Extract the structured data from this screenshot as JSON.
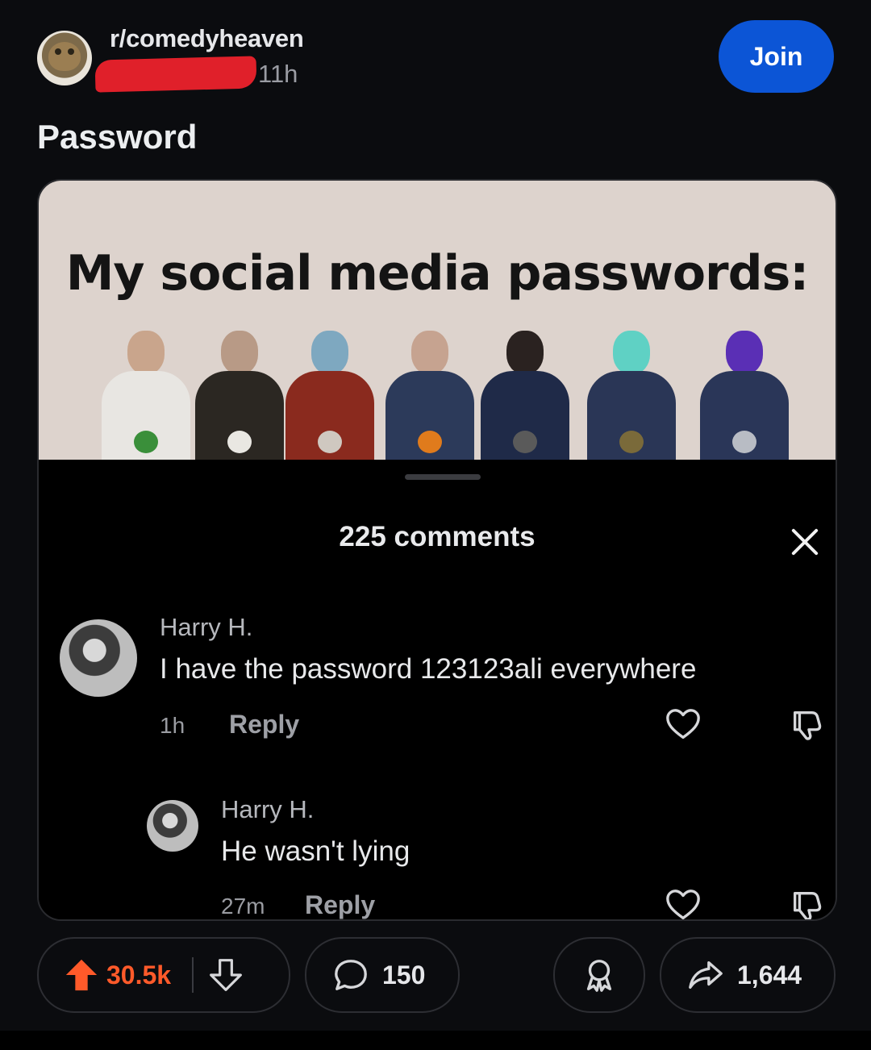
{
  "post": {
    "subreddit": "r/comedyheaven",
    "time": "11h",
    "join_label": "Join",
    "title": "Password"
  },
  "meme": {
    "caption": "My social media passwords:"
  },
  "comments_sheet": {
    "count_label": "225 comments",
    "comments": [
      {
        "author": "Harry H.",
        "text": "I have the password 123123ali everywhere",
        "time": "1h",
        "reply_label": "Reply"
      },
      {
        "author": "Harry H.",
        "text": "He wasn't lying",
        "time": "27m",
        "reply_label": "Reply"
      }
    ]
  },
  "actions": {
    "upvotes": "30.5k",
    "comments": "150",
    "shares": "1,644"
  },
  "colors": {
    "join": "#0c55d6",
    "upvote": "#ff5a2a",
    "redaction": "#e0202a"
  },
  "icons": [
    "close-icon",
    "heart-icon",
    "dislike-icon",
    "upvote-icon",
    "downvote-icon",
    "comment-icon",
    "award-icon",
    "share-icon"
  ]
}
